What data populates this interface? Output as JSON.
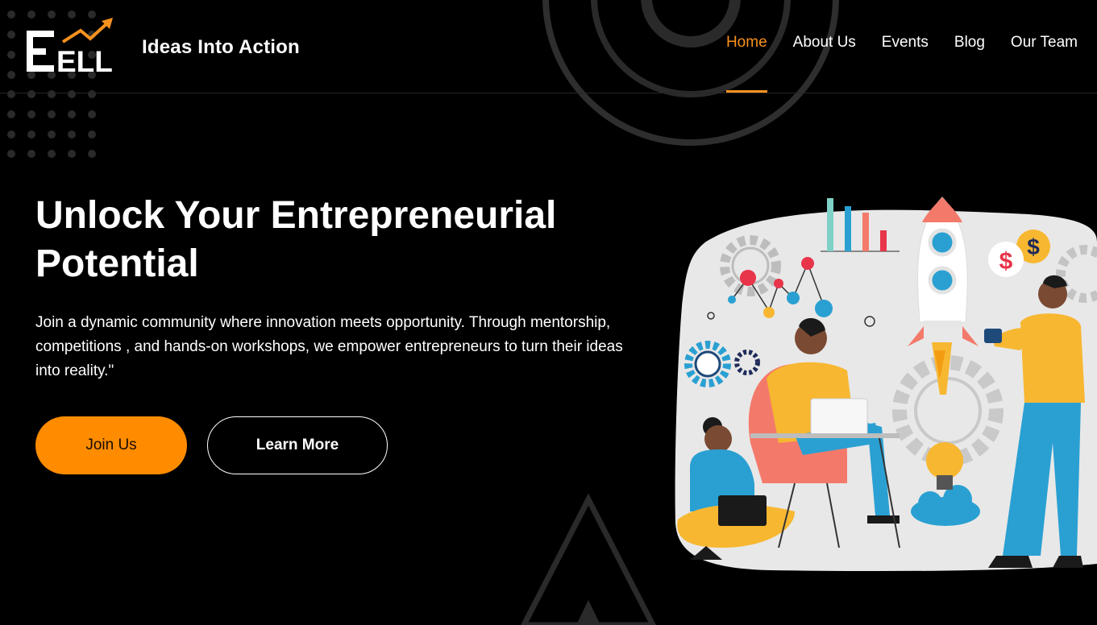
{
  "header": {
    "logo_text": "ELL",
    "tagline": "Ideas Into Action",
    "nav": [
      {
        "label": "Home",
        "active": true
      },
      {
        "label": "About Us",
        "active": false
      },
      {
        "label": "Events",
        "active": false
      },
      {
        "label": "Blog",
        "active": false
      },
      {
        "label": "Our Team",
        "active": false
      }
    ]
  },
  "hero": {
    "title_line1": "Unlock Your Entrepreneurial",
    "title_line2": "Potential",
    "description": "Join a dynamic community where innovation meets opportunity. Through mentorship, competitions , and hands-on workshops, we empower entrepreneurs to turn their ideas into reality.\"",
    "join_label": "Join Us",
    "learn_label": "Learn More"
  },
  "illustration": {
    "icons": [
      "bar-chart-icon",
      "rocket-icon",
      "dollar-coin-icon",
      "gear-icon",
      "lightbulb-icon",
      "cloud-icon",
      "laptop-icon"
    ],
    "dollar_symbol": "$"
  },
  "colors": {
    "accent": "#f7911e",
    "button_fill": "#ff8c00",
    "background": "#000000",
    "illustration_bg": "#e8e8e8"
  }
}
